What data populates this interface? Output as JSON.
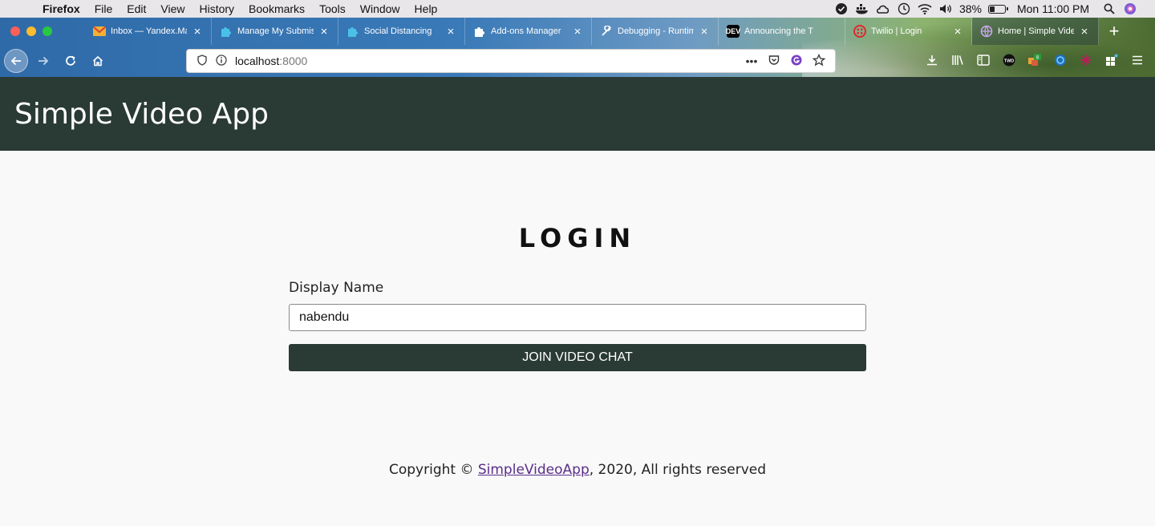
{
  "menubar": {
    "items": [
      "Firefox",
      "File",
      "Edit",
      "View",
      "History",
      "Bookmarks",
      "Tools",
      "Window",
      "Help"
    ],
    "battery_percent": "38%",
    "battery_level": 0.38,
    "clock": "Mon 11:00 PM",
    "status_icons": [
      "check-circle-icon",
      "docker-icon",
      "creative-cloud-icon",
      "time-machine-icon",
      "wifi-icon",
      "volume-icon"
    ]
  },
  "tabs": [
    {
      "title": "Inbox — Yandex.Mail",
      "icon": "gmail-icon",
      "color": "#d44638"
    },
    {
      "title": "Manage My Submissions",
      "icon": "puzzle-blue-icon",
      "color": "#4ac0e8"
    },
    {
      "title": "Social Distancing",
      "icon": "puzzle-blue-icon",
      "color": "#4ac0e8"
    },
    {
      "title": "Add-ons Manager",
      "icon": "puzzle-icon",
      "color": "#ffffff"
    },
    {
      "title": "Debugging - Runtime",
      "icon": "wrench-icon",
      "color": "#ffffff"
    },
    {
      "title": "Announcing the T",
      "icon": "dev-icon",
      "color": "#000000",
      "badge": "DEV"
    },
    {
      "title": "Twilio | Login",
      "icon": "twilio-icon",
      "color": "#e0282e"
    },
    {
      "title": "Home | Simple Video App",
      "icon": "globe-icon",
      "color": "#9b59d0"
    }
  ],
  "urlbar": {
    "host": "localhost",
    "port": ":8000"
  },
  "app": {
    "title": "Simple Video App",
    "login_heading": "LOGIN",
    "display_name_label": "Display Name",
    "display_name_value": "nabendu",
    "join_button_label": "JOIN VIDEO CHAT",
    "footer_prefix": "Copyright © ",
    "footer_link": "SimpleVideoApp",
    "footer_suffix": ", 2020, All rights reserved",
    "header_color": "#2a3a35",
    "link_color": "#5a2e8a"
  }
}
